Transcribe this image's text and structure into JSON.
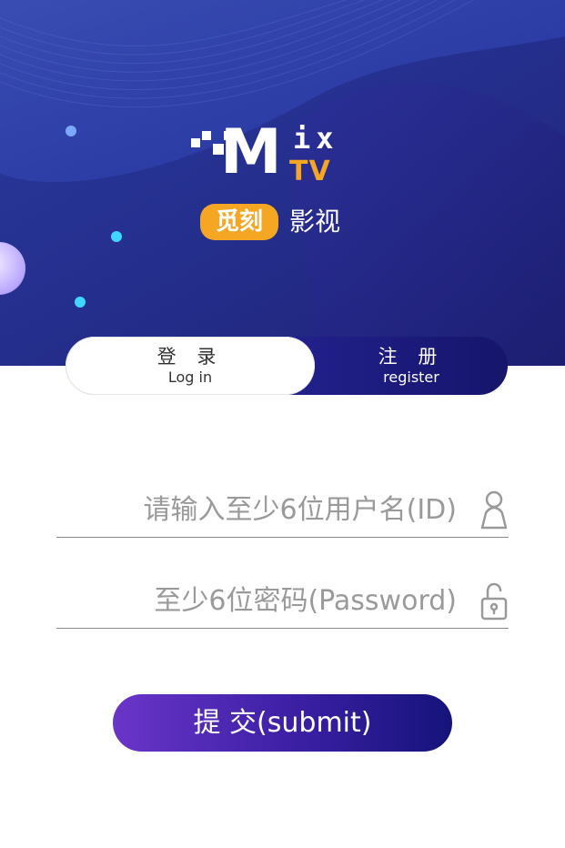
{
  "brand": {
    "logo_m": "M",
    "logo_ix": "ix",
    "logo_tv": "TV",
    "badge": "觅刻",
    "suffix": "影视"
  },
  "tabs": {
    "login_cn": "登 录",
    "login_en": "Log in",
    "register_cn": "注 册",
    "register_en": "register"
  },
  "form": {
    "username_placeholder": "请输入至少6位用户名(ID)",
    "password_placeholder": "至少6位密码(Password)",
    "submit_label": "提 交(submit)"
  },
  "icons": {
    "username": "user-icon",
    "password": "unlock-icon"
  },
  "colors": {
    "hero_bg": "#25308f",
    "accent_orange": "#f5a623",
    "button_start": "#6a35c9",
    "button_end": "#15137a"
  }
}
